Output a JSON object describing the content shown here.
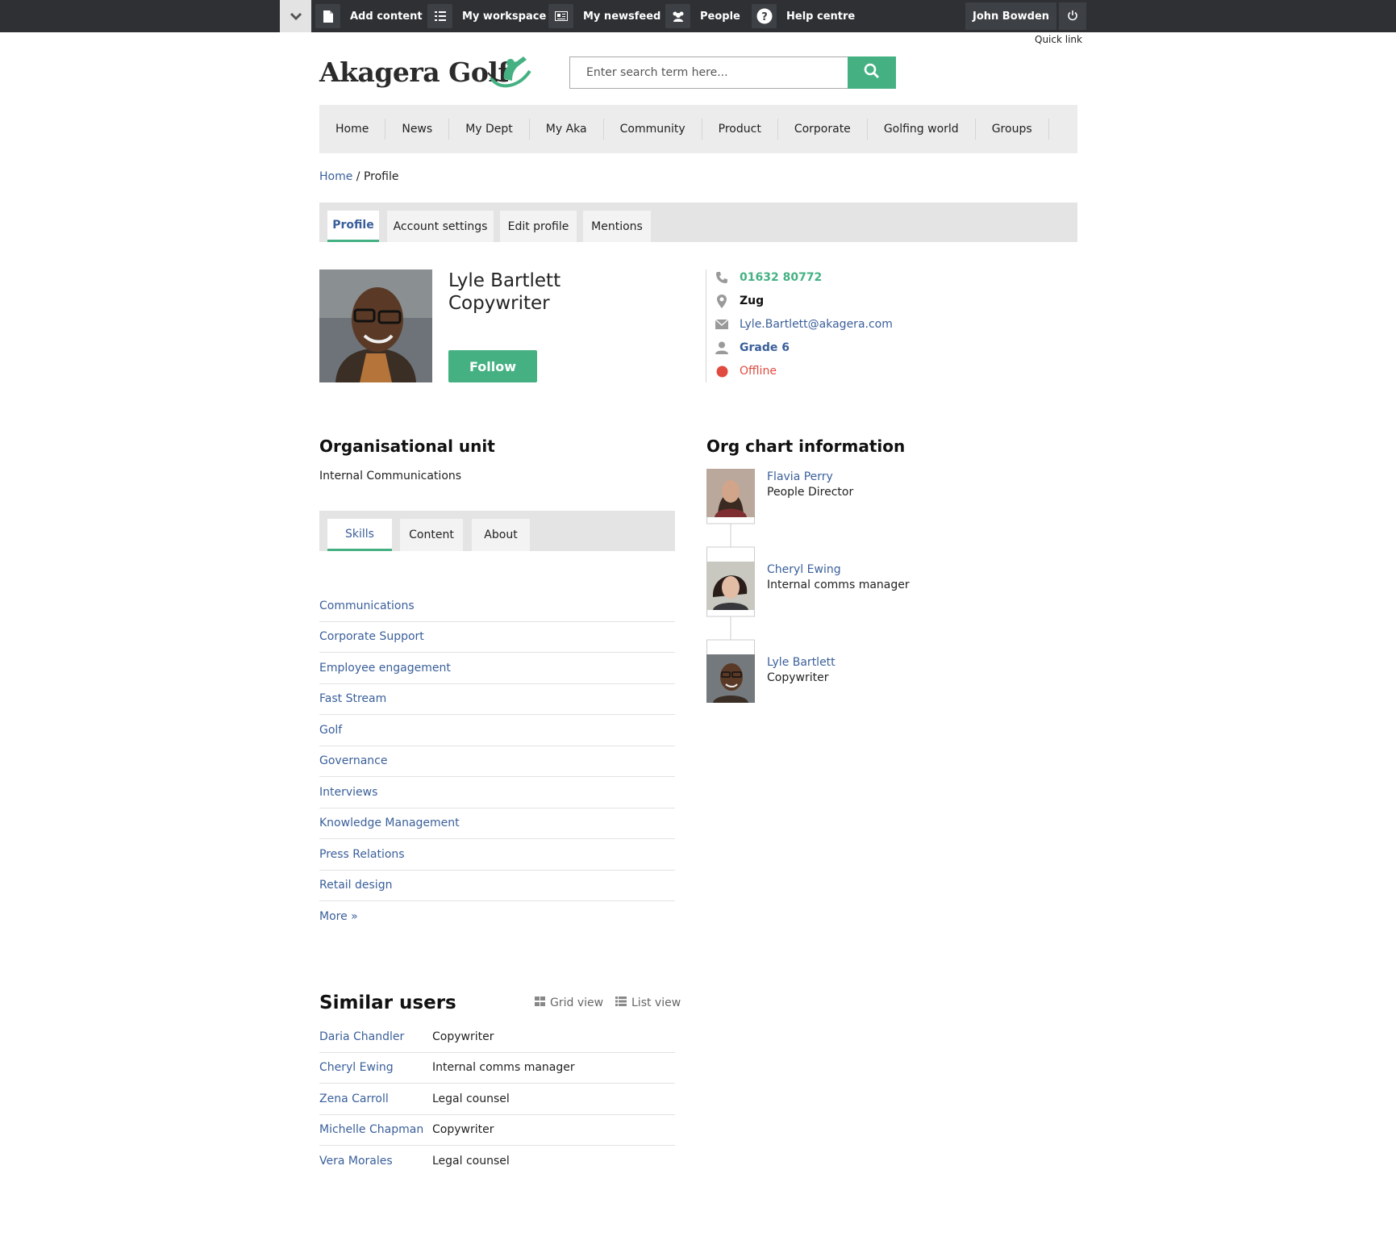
{
  "topbar": {
    "add_content": "Add content",
    "my_workspace": "My workspace",
    "my_newsfeed": "My newsfeed",
    "people": "People",
    "help_centre": "Help centre",
    "user_name": "John Bowden",
    "quick_link": "Quick link"
  },
  "header": {
    "logo_text": "Akagera Golf",
    "search_placeholder": "Enter search term here..."
  },
  "nav": {
    "items": [
      "Home",
      "News",
      "My Dept",
      "My Aka",
      "Community",
      "Product",
      "Corporate",
      "Golfing world",
      "Groups"
    ]
  },
  "breadcrumb": {
    "home": "Home",
    "separator": " / ",
    "current": "Profile"
  },
  "profile_tabs": [
    "Profile",
    "Account settings",
    "Edit profile",
    "Mentions"
  ],
  "profile": {
    "name": "Lyle Bartlett",
    "title": "Copywriter",
    "follow_label": "Follow",
    "phone": "01632 80772",
    "location": "Zug",
    "email": "Lyle.Bartlett@akagera.com",
    "grade": "Grade 6",
    "status": "Offline"
  },
  "org_unit": {
    "heading": "Organisational unit",
    "value": "Internal Communications"
  },
  "section_tabs": [
    "Skills",
    "Content",
    "About"
  ],
  "skills": [
    "Communications",
    "Corporate Support",
    "Employee engagement",
    "Fast Stream",
    "Golf",
    "Governance",
    "Interviews",
    "Knowledge Management",
    "Press Relations",
    "Retail design"
  ],
  "skills_more": "More »",
  "org_chart": {
    "heading": "Org chart information",
    "people": [
      {
        "name": "Flavia Perry",
        "role": "People Director"
      },
      {
        "name": "Cheryl Ewing",
        "role": "Internal comms manager"
      },
      {
        "name": "Lyle Bartlett",
        "role": "Copywriter"
      }
    ]
  },
  "similar_users": {
    "heading": "Similar users",
    "grid_view": "Grid view",
    "list_view": "List view",
    "rows": [
      {
        "name": "Daria Chandler",
        "role": "Copywriter"
      },
      {
        "name": "Cheryl Ewing",
        "role": "Internal comms manager"
      },
      {
        "name": "Zena Carroll",
        "role": "Legal counsel"
      },
      {
        "name": "Michelle Chapman",
        "role": "Copywriter"
      },
      {
        "name": "Vera Morales",
        "role": "Legal counsel"
      }
    ]
  },
  "colors": {
    "accent_green": "#45b183",
    "link_blue": "#3a5f9a",
    "offline_red": "#e04a3f",
    "topbar_bg": "#2e3033"
  }
}
